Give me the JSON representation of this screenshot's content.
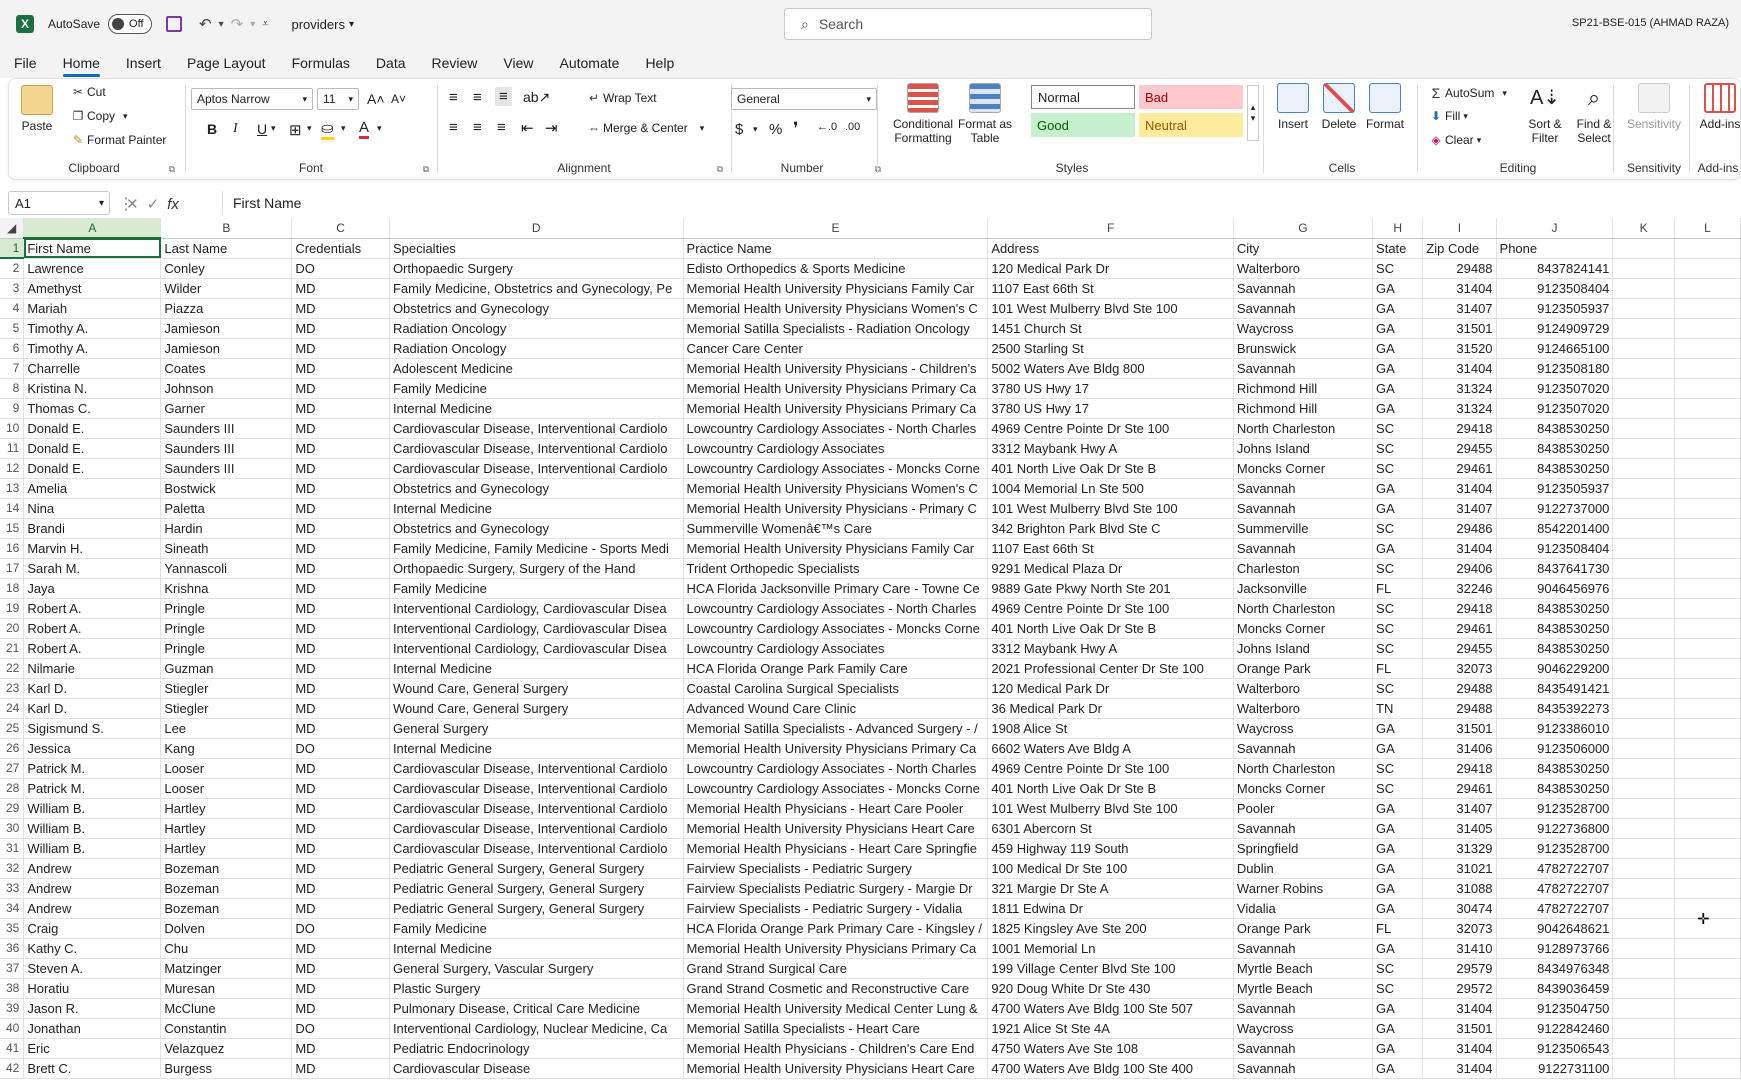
{
  "titlebar": {
    "autosave_label": "AutoSave",
    "autosave_state": "Off",
    "doc_name": "providers",
    "search_placeholder": "Search",
    "user": "SP21-BSE-015 (AHMAD RAZA)"
  },
  "menu": [
    "File",
    "Home",
    "Insert",
    "Page Layout",
    "Formulas",
    "Data",
    "Review",
    "View",
    "Automate",
    "Help"
  ],
  "ribbon": {
    "clipboard": {
      "paste": "Paste",
      "cut": "Cut",
      "copy": "Copy",
      "format_painter": "Format Painter",
      "label": "Clipboard"
    },
    "font": {
      "name": "Aptos Narrow",
      "size": "11",
      "label": "Font",
      "bold": "B",
      "italic": "I",
      "underline": "U"
    },
    "alignment": {
      "wrap": "Wrap Text",
      "merge": "Merge & Center",
      "label": "Alignment"
    },
    "number": {
      "format": "General",
      "label": "Number"
    },
    "styles": {
      "conditional": "Conditional Formatting",
      "format_table": "Format as Table",
      "normal": "Normal",
      "bad": "Bad",
      "good": "Good",
      "neutral": "Neutral",
      "label": "Styles"
    },
    "cells": {
      "insert": "Insert",
      "delete": "Delete",
      "format": "Format",
      "label": "Cells"
    },
    "editing": {
      "autosum": "AutoSum",
      "fill": "Fill",
      "clear": "Clear",
      "sort": "Sort & Filter",
      "find": "Find & Select",
      "label": "Editing"
    },
    "sensitivity": {
      "btn": "Sensitivity",
      "label": "Sensitivity"
    },
    "addins": {
      "btn": "Add-ins",
      "label": "Add-ins"
    }
  },
  "formula_bar": {
    "name_box": "A1",
    "value": "First Name"
  },
  "columns": [
    "A",
    "B",
    "C",
    "D",
    "E",
    "F",
    "G",
    "H",
    "I",
    "J",
    "K",
    "L"
  ],
  "rows": [
    [
      "First Name",
      "Last Name",
      "Credentials",
      "Specialties",
      "Practice Name",
      "Address",
      "City",
      "State",
      "Zip Code",
      "Phone"
    ],
    [
      "Lawrence",
      "Conley",
      "DO",
      "Orthopaedic Surgery",
      "Edisto Orthopedics & Sports Medicine",
      "120 Medical Park Dr",
      "Walterboro",
      "SC",
      "29488",
      "8437824141"
    ],
    [
      "Amethyst",
      "Wilder",
      "MD",
      "Family Medicine, Obstetrics and Gynecology, Pe",
      "Memorial Health University Physicians Family Car",
      "1107 East 66th St",
      "Savannah",
      "GA",
      "31404",
      "9123508404"
    ],
    [
      "Mariah",
      "Piazza",
      "MD",
      "Obstetrics and Gynecology",
      "Memorial Health University Physicians Women's C",
      "101 West Mulberry Blvd Ste 100",
      "Savannah",
      "GA",
      "31407",
      "9123505937"
    ],
    [
      "Timothy A.",
      "Jamieson",
      "MD",
      "Radiation Oncology",
      "Memorial Satilla Specialists - Radiation Oncology",
      "1451 Church St",
      "Waycross",
      "GA",
      "31501",
      "9124909729"
    ],
    [
      "Timothy A.",
      "Jamieson",
      "MD",
      "Radiation Oncology",
      "Cancer Care Center",
      "2500 Starling St",
      "Brunswick",
      "GA",
      "31520",
      "9124665100"
    ],
    [
      "Charrelle",
      "Coates",
      "MD",
      "Adolescent Medicine",
      "Memorial Health University Physicians - Children's",
      "5002 Waters Ave Bldg 800",
      "Savannah",
      "GA",
      "31404",
      "9123508180"
    ],
    [
      "Kristina N.",
      "Johnson",
      "MD",
      "Family Medicine",
      "Memorial Health University Physicians Primary Ca",
      "3780 US Hwy 17",
      "Richmond Hill",
      "GA",
      "31324",
      "9123507020"
    ],
    [
      "Thomas C.",
      "Garner",
      "MD",
      "Internal Medicine",
      "Memorial Health University Physicians Primary Ca",
      "3780 US Hwy 17",
      "Richmond Hill",
      "GA",
      "31324",
      "9123507020"
    ],
    [
      "Donald E.",
      "Saunders III",
      "MD",
      "Cardiovascular Disease, Interventional Cardiolo",
      "Lowcountry Cardiology Associates - North Charles",
      "4969 Centre Pointe Dr Ste 100",
      "North Charleston",
      "SC",
      "29418",
      "8438530250"
    ],
    [
      "Donald E.",
      "Saunders III",
      "MD",
      "Cardiovascular Disease, Interventional Cardiolo",
      "Lowcountry Cardiology Associates",
      "3312 Maybank Hwy A",
      "Johns Island",
      "SC",
      "29455",
      "8438530250"
    ],
    [
      "Donald E.",
      "Saunders III",
      "MD",
      "Cardiovascular Disease, Interventional Cardiolo",
      "Lowcountry Cardiology Associates - Moncks Corne",
      "401 North Live Oak Dr Ste B",
      "Moncks Corner",
      "SC",
      "29461",
      "8438530250"
    ],
    [
      "Amelia",
      "Bostwick",
      "MD",
      "Obstetrics and Gynecology",
      "Memorial Health University Physicians Women's C",
      "1004 Memorial Ln Ste 500",
      "Savannah",
      "GA",
      "31404",
      "9123505937"
    ],
    [
      "Nina",
      "Paletta",
      "MD",
      "Internal Medicine",
      "Memorial Health University Physicians - Primary C",
      "101 West Mulberry Blvd Ste 100",
      "Savannah",
      "GA",
      "31407",
      "9122737000"
    ],
    [
      "Brandi",
      "Hardin",
      "MD",
      "Obstetrics and Gynecology",
      "Summerville Womenâ€™s Care",
      "342 Brighton Park Blvd Ste C",
      "Summerville",
      "SC",
      "29486",
      "8542201400"
    ],
    [
      "Marvin H.",
      "Sineath",
      "MD",
      "Family Medicine, Family Medicine - Sports Medi",
      "Memorial Health University Physicians Family Car",
      "1107 East 66th St",
      "Savannah",
      "GA",
      "31404",
      "9123508404"
    ],
    [
      "Sarah M.",
      "Yannascoli",
      "MD",
      "Orthopaedic Surgery, Surgery of the Hand",
      "Trident Orthopedic Specialists",
      "9291 Medical Plaza Dr",
      "Charleston",
      "SC",
      "29406",
      "8437641730"
    ],
    [
      "Jaya",
      "Krishna",
      "MD",
      "Family Medicine",
      "HCA Florida Jacksonville Primary Care - Towne Ce",
      "9889 Gate Pkwy North Ste 201",
      "Jacksonville",
      "FL",
      "32246",
      "9046456976"
    ],
    [
      "Robert A.",
      "Pringle",
      "MD",
      "Interventional Cardiology, Cardiovascular Disea",
      "Lowcountry Cardiology Associates - North Charles",
      "4969 Centre Pointe Dr Ste 100",
      "North Charleston",
      "SC",
      "29418",
      "8438530250"
    ],
    [
      "Robert A.",
      "Pringle",
      "MD",
      "Interventional Cardiology, Cardiovascular Disea",
      "Lowcountry Cardiology Associates - Moncks Corne",
      "401 North Live Oak Dr Ste B",
      "Moncks Corner",
      "SC",
      "29461",
      "8438530250"
    ],
    [
      "Robert A.",
      "Pringle",
      "MD",
      "Interventional Cardiology, Cardiovascular Disea",
      "Lowcountry Cardiology Associates",
      "3312 Maybank Hwy A",
      "Johns Island",
      "SC",
      "29455",
      "8438530250"
    ],
    [
      "Nilmarie",
      "Guzman",
      "MD",
      "Internal Medicine",
      "HCA Florida Orange Park Family Care",
      "2021 Professional Center Dr Ste 100",
      "Orange Park",
      "FL",
      "32073",
      "9046229200"
    ],
    [
      "Karl D.",
      "Stiegler",
      "MD",
      "Wound Care, General Surgery",
      "Coastal Carolina Surgical Specialists",
      "120 Medical Park Dr",
      "Walterboro",
      "SC",
      "29488",
      "8435491421"
    ],
    [
      "Karl D.",
      "Stiegler",
      "MD",
      "Wound Care, General Surgery",
      "Advanced Wound Care Clinic",
      "36 Medical Park Dr",
      "Walterboro",
      "TN",
      "29488",
      "8435392273"
    ],
    [
      "Sigismund S.",
      "Lee",
      "MD",
      "General Surgery",
      "Memorial Satilla Specialists - Advanced Surgery - /",
      "1908 Alice St",
      "Waycross",
      "GA",
      "31501",
      "9123386010"
    ],
    [
      "Jessica",
      "Kang",
      "DO",
      "Internal Medicine",
      "Memorial Health University Physicians Primary Ca",
      "6602 Waters Ave Bldg A",
      "Savannah",
      "GA",
      "31406",
      "9123506000"
    ],
    [
      "Patrick M.",
      "Looser",
      "MD",
      "Cardiovascular Disease, Interventional Cardiolo",
      "Lowcountry Cardiology Associates - North Charles",
      "4969 Centre Pointe Dr Ste 100",
      "North Charleston",
      "SC",
      "29418",
      "8438530250"
    ],
    [
      "Patrick M.",
      "Looser",
      "MD",
      "Cardiovascular Disease, Interventional Cardiolo",
      "Lowcountry Cardiology Associates - Moncks Corne",
      "401 North Live Oak Dr Ste B",
      "Moncks Corner",
      "SC",
      "29461",
      "8438530250"
    ],
    [
      "William B.",
      "Hartley",
      "MD",
      "Cardiovascular Disease, Interventional Cardiolo",
      "Memorial Health Physicians - Heart Care Pooler",
      "101 West Mulberry Blvd Ste 100",
      "Pooler",
      "GA",
      "31407",
      "9123528700"
    ],
    [
      "William B.",
      "Hartley",
      "MD",
      "Cardiovascular Disease, Interventional Cardiolo",
      "Memorial Health University Physicians Heart Care",
      "6301 Abercorn St",
      "Savannah",
      "GA",
      "31405",
      "9122736800"
    ],
    [
      "William B.",
      "Hartley",
      "MD",
      "Cardiovascular Disease, Interventional Cardiolo",
      "Memorial Health Physicians - Heart Care Springfie",
      "459 Highway 119 South",
      "Springfield",
      "GA",
      "31329",
      "9123528700"
    ],
    [
      "Andrew",
      "Bozeman",
      "MD",
      "Pediatric General Surgery, General Surgery",
      "Fairview Specialists - Pediatric Surgery",
      "100 Medical Dr Ste 100",
      "Dublin",
      "GA",
      "31021",
      "4782722707"
    ],
    [
      "Andrew",
      "Bozeman",
      "MD",
      "Pediatric General Surgery, General Surgery",
      "Fairview Specialists Pediatric Surgery - Margie Dr",
      "321 Margie Dr Ste A",
      "Warner Robins",
      "GA",
      "31088",
      "4782722707"
    ],
    [
      "Andrew",
      "Bozeman",
      "MD",
      "Pediatric General Surgery, General Surgery",
      "Fairview Specialists - Pediatric Surgery - Vidalia",
      "1811 Edwina Dr",
      "Vidalia",
      "GA",
      "30474",
      "4782722707"
    ],
    [
      "Craig",
      "Dolven",
      "DO",
      "Family Medicine",
      "HCA Florida Orange Park Primary Care - Kingsley /",
      "1825 Kingsley Ave Ste 200",
      "Orange Park",
      "FL",
      "32073",
      "9042648621"
    ],
    [
      "Kathy C.",
      "Chu",
      "MD",
      "Internal Medicine",
      "Memorial Health University Physicians Primary Ca",
      "1001 Memorial Ln",
      "Savannah",
      "GA",
      "31410",
      "9128973766"
    ],
    [
      "Steven A.",
      "Matzinger",
      "MD",
      "General Surgery, Vascular Surgery",
      "Grand Strand Surgical Care",
      "199 Village Center Blvd Ste 100",
      "Myrtle Beach",
      "SC",
      "29579",
      "8434976348"
    ],
    [
      "Horatiu",
      "Muresan",
      "MD",
      "Plastic Surgery",
      "Grand Strand Cosmetic and Reconstructive Care",
      "920 Doug White Dr Ste 430",
      "Myrtle Beach",
      "SC",
      "29572",
      "8439036459"
    ],
    [
      "Jason R.",
      "McClune",
      "MD",
      "Pulmonary Disease, Critical Care Medicine",
      "Memorial Health University Medical Center Lung &",
      "4700 Waters Ave Bldg 100 Ste 507",
      "Savannah",
      "GA",
      "31404",
      "9123504750"
    ],
    [
      "Jonathan",
      "Constantin",
      "DO",
      "Interventional Cardiology, Nuclear Medicine, Ca",
      "Memorial Satilla Specialists - Heart Care",
      "1921 Alice St Ste 4A",
      "Waycross",
      "GA",
      "31501",
      "9122842460"
    ],
    [
      "Eric",
      "Velazquez",
      "MD",
      "Pediatric Endocrinology",
      "Memorial Health Physicians - Children's Care End",
      "4750 Waters Ave Ste 108",
      "Savannah",
      "GA",
      "31404",
      "9123506543"
    ],
    [
      "Brett C.",
      "Burgess",
      "MD",
      "Cardiovascular Disease",
      "Memorial Health University Physicians Heart Care",
      "4700 Waters Ave Bldg 100 Ste 400",
      "Savannah",
      "GA",
      "31404",
      "9122731100"
    ]
  ]
}
